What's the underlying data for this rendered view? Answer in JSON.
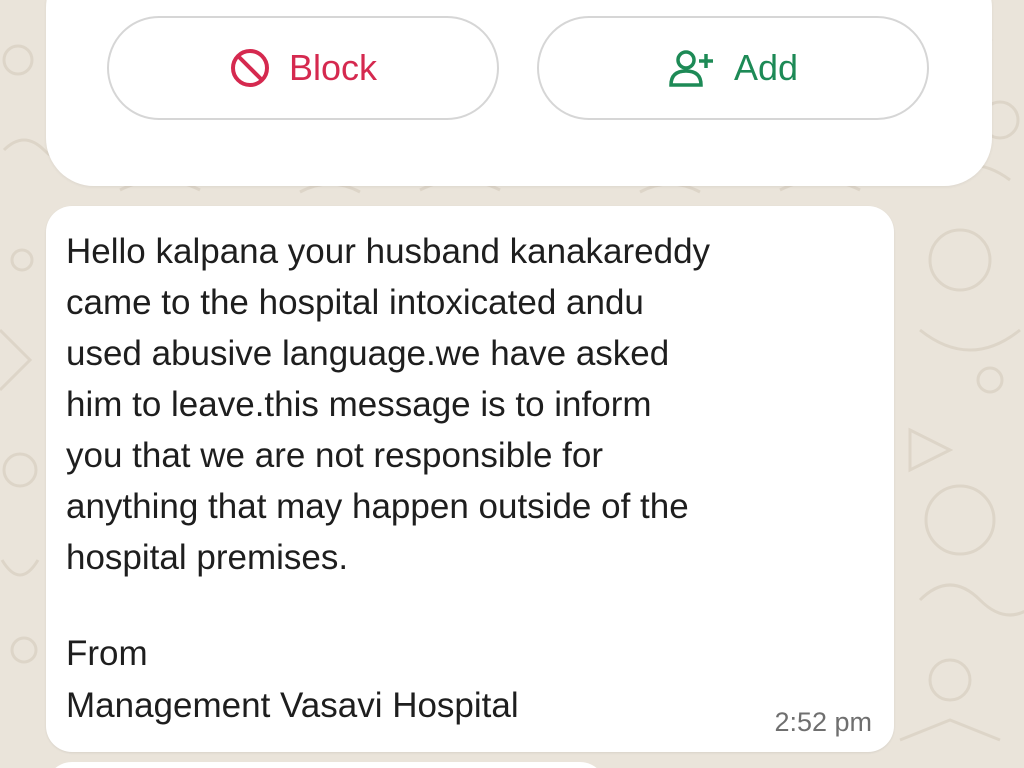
{
  "actions": {
    "block": {
      "label": "Block",
      "icon": "block-icon",
      "color": "#d5294f"
    },
    "add": {
      "label": "Add",
      "icon": "add-person-icon",
      "color": "#1d8a56"
    }
  },
  "message": {
    "body": "Hello kalpana your husband kanakareddy\ncame to the hospital intoxicated andu\nused abusive language.we have asked\nhim to leave.this message is to inform\nyou that we are not responsible for\nanything that may happen outside of the\nhospital premises.",
    "from_label": "From",
    "sender": "Management Vasavi Hospital",
    "time": "2:52 pm"
  },
  "colors": {
    "background": "#eae4da",
    "bubble": "#ffffff",
    "text": "#1e1e1e",
    "timestamp": "#6f6f6f"
  }
}
